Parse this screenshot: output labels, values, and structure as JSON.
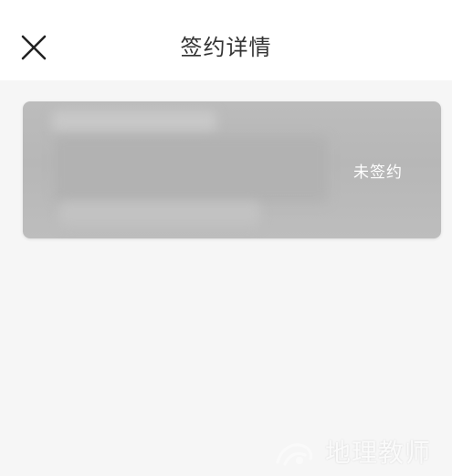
{
  "header": {
    "title": "签约详情",
    "close_icon": "close-icon"
  },
  "card": {
    "status": "未签约"
  },
  "watermark": {
    "text": "地理教师"
  },
  "colors": {
    "page_background": "#f6f6f6",
    "header_background": "#ffffff",
    "card_background": "#bbbbbb",
    "title_text": "#333333",
    "status_text": "#ffffff"
  }
}
